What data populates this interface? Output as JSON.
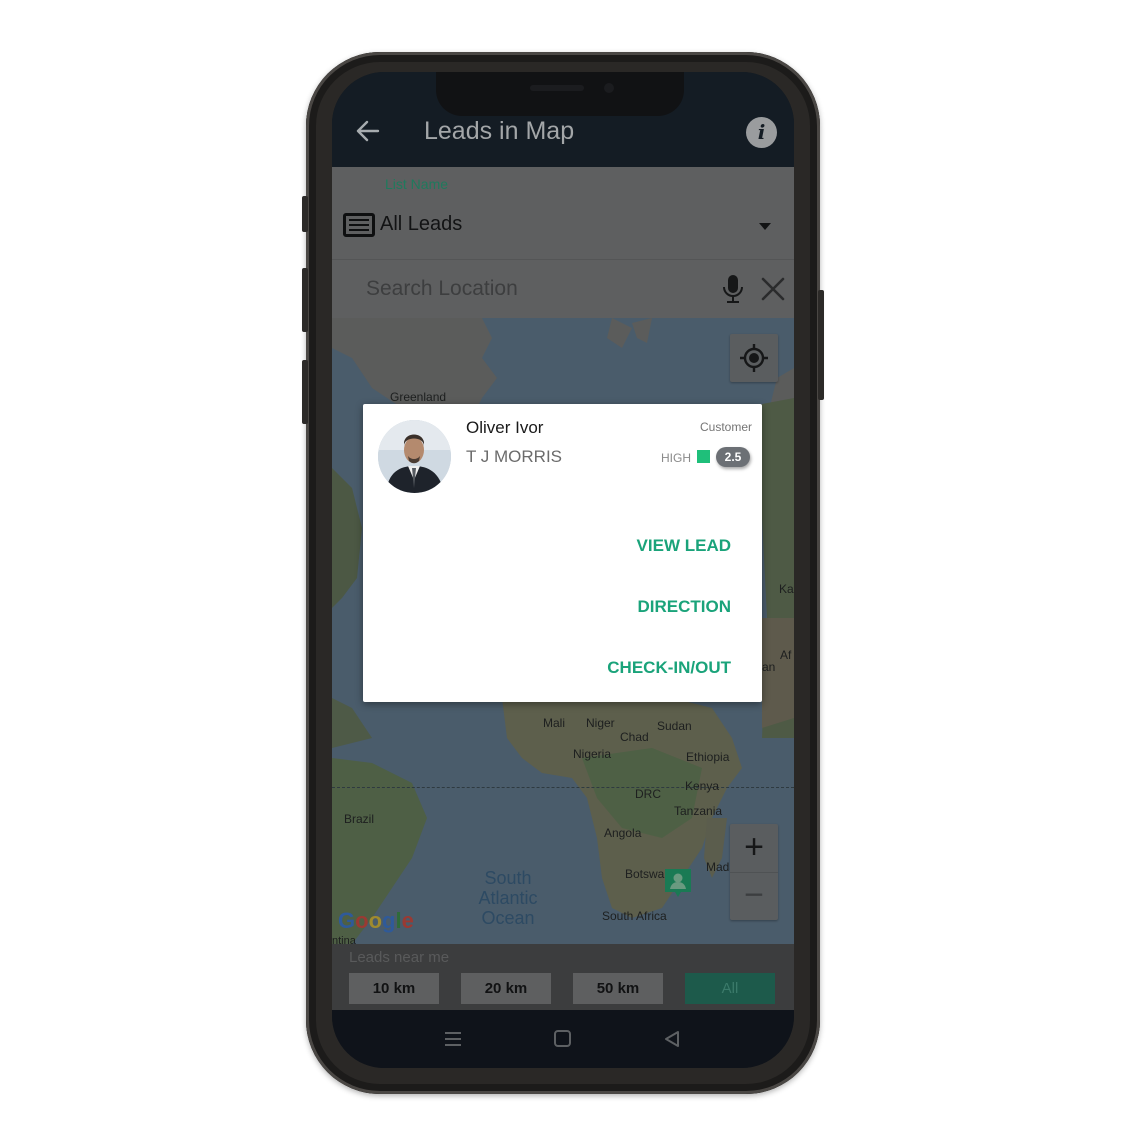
{
  "appbar": {
    "title": "Leads in Map",
    "back_icon": "arrow-left-icon",
    "info_icon": "info-icon"
  },
  "list_selector": {
    "label": "List Name",
    "value": "All Leads",
    "icon": "list-icon"
  },
  "search": {
    "placeholder": "Search Location",
    "value": "",
    "mic_icon": "microphone-icon",
    "clear_icon": "close-icon"
  },
  "map": {
    "labels": {
      "greenland": "Greenland",
      "mali": "Mali",
      "niger": "Niger",
      "sudan": "Sudan",
      "chad": "Chad",
      "nigeria": "Nigeria",
      "ethiopia": "Ethiopia",
      "drc": "DRC",
      "kenya": "Kenya",
      "tanzania": "Tanzania",
      "brazil": "Brazil",
      "angola": "Angola",
      "botswana": "Botswa",
      "madagascar": "Madagascar",
      "south_africa": "South Africa",
      "kazakh_partial": "Ka",
      "afghan_partial": "Af",
      "pakistan_partial": "an",
      "argentina_partial": "ntina",
      "ocean_line1": "South",
      "ocean_line2": "Atlantic",
      "ocean_line3": "Ocean"
    },
    "attribution": "Google",
    "controls": {
      "zoom_in": "+",
      "zoom_out": "−",
      "locate_icon": "my-location-icon"
    },
    "marker_icon": "lead-pin-icon"
  },
  "lead_card": {
    "name": "Oliver Ivor",
    "company": "T J MORRIS",
    "type": "Customer",
    "priority": "HIGH",
    "priority_color": "#1fbf7a",
    "score": "2.5",
    "actions": {
      "view_lead": "VIEW LEAD",
      "direction": "DIRECTION",
      "check_in_out": "CHECK-IN/OUT"
    },
    "accent_color": "#1aa37a"
  },
  "leads_near_me": {
    "label": "Leads near me",
    "options": [
      "10 km",
      "20 km",
      "50 km",
      "All"
    ],
    "selected": "All"
  },
  "system_nav": {
    "menu_icon": "menu-icon",
    "home_icon": "home-icon",
    "back_icon": "back-triangle-icon"
  }
}
